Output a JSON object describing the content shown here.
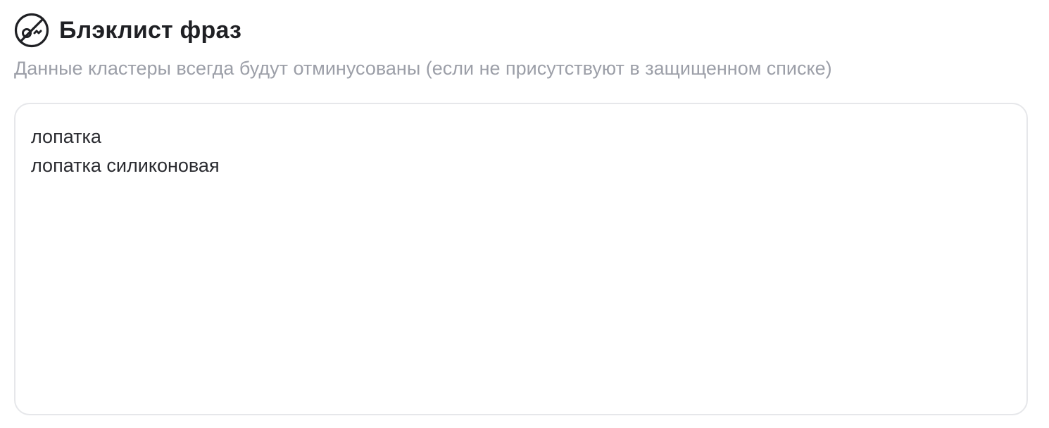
{
  "section": {
    "icon": "blacklist-icon",
    "title": "Блэклист фраз",
    "subtitle": "Данные кластеры всегда будут отминусованы (если не присутствуют в защищенном списке)"
  },
  "blacklist": {
    "value": "лопатка\nлопатка силиконовая"
  },
  "colors": {
    "title": "#1f2024",
    "subtitle": "#9c9fa8",
    "border": "#e6e7ea",
    "text": "#2a2b30"
  }
}
